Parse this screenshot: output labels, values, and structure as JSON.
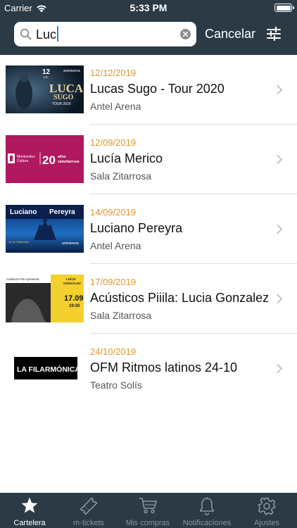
{
  "status_bar": {
    "carrier": "Carrier",
    "time": "5:33 PM"
  },
  "search": {
    "value": "Luc",
    "cancel_label": "Cancelar"
  },
  "results": [
    {
      "date": "12/12/2019",
      "title": "Lucas Sugo - Tour 2020",
      "venue": "Antel Arena",
      "poster_text": [
        "12",
        "DIC",
        "antelarena",
        "LUCAS",
        "SUGO",
        "TOUR 2020"
      ]
    },
    {
      "date": "12/09/2019",
      "title": "Lucía Merico",
      "venue": "Sala Zitarrosa",
      "poster_text": [
        "Montevideo",
        "Cultura",
        "20",
        "años",
        "salazitarrosa"
      ]
    },
    {
      "date": "14/09/2019",
      "title": "Luciano Pereyra",
      "venue": "Antel Arena",
      "poster_text": [
        "Luciano",
        "Pereyra",
        "14 de Setiembre",
        "antelarena"
      ]
    },
    {
      "date": "17/09/2019",
      "title": "Acústicos Piiila: Lucia Gonzalez",
      "venue": "Sala Zitarrosa",
      "poster_text": [
        "Acústicos PiiLA presenta:",
        "LUCIA",
        "GONZÁLEZ",
        "17.09",
        "19:30"
      ]
    },
    {
      "date": "24/10/2019",
      "title": "OFM Ritmos latinos 24-10",
      "venue": "Teatro Solís",
      "poster_text": [
        "LA FILARMÓNICA"
      ]
    }
  ],
  "tabs": [
    {
      "label": "Cartelera",
      "icon": "star-icon",
      "active": true
    },
    {
      "label": "m-tickets",
      "icon": "ticket-icon",
      "active": false
    },
    {
      "label": "Mis compras",
      "icon": "cart-icon",
      "active": false
    },
    {
      "label": "Notificaciones",
      "icon": "bell-icon",
      "active": false
    },
    {
      "label": "Ajustes",
      "icon": "gear-icon",
      "active": false
    }
  ],
  "colors": {
    "header": "#2b3a45",
    "date": "#e0962b",
    "tab_inactive": "#8896a0",
    "caret": "#2f7df6"
  }
}
